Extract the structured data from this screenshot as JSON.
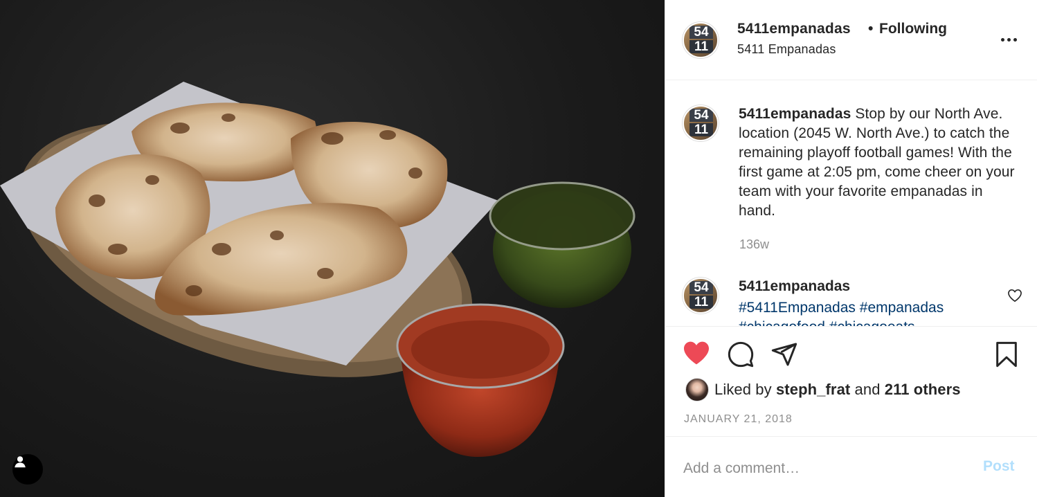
{
  "post": {
    "image_alt": "Empanadas on a wooden tray with chimichurri and salsa",
    "user_tag_icon": "person-icon"
  },
  "header": {
    "avatar_top": "54",
    "avatar_bottom": "11",
    "username": "5411empanadas",
    "separator": "•",
    "follow_status": "Following",
    "subtitle": "5411 Empanadas",
    "more_icon": "more-horizontal-icon"
  },
  "caption": {
    "username": "5411empanadas",
    "text": "Stop by our North Ave. location (2045 W. North Ave.) to catch the remaining playoff football games! With the first game at 2:05 pm, come cheer on your team with your favorite empanadas in hand.",
    "time": "136w"
  },
  "comment2": {
    "username": "5411empanadas",
    "tags": [
      "#5411Empanadas",
      "#empanadas"
    ],
    "more_tags": "#chicagofood #chicagoeats",
    "heart_icon": "heart-outline-icon"
  },
  "actions": {
    "like_icon": "heart-filled-icon",
    "comment_icon": "comment-icon",
    "share_icon": "share-icon",
    "save_icon": "bookmark-icon",
    "like_color": "#ed4956"
  },
  "likes": {
    "prefix": "Liked by",
    "user": "steph_frat",
    "and": "and",
    "others": "211 others"
  },
  "date": "JANUARY 21, 2018",
  "comment_box": {
    "placeholder": "Add a comment…",
    "post_label": "Post"
  }
}
